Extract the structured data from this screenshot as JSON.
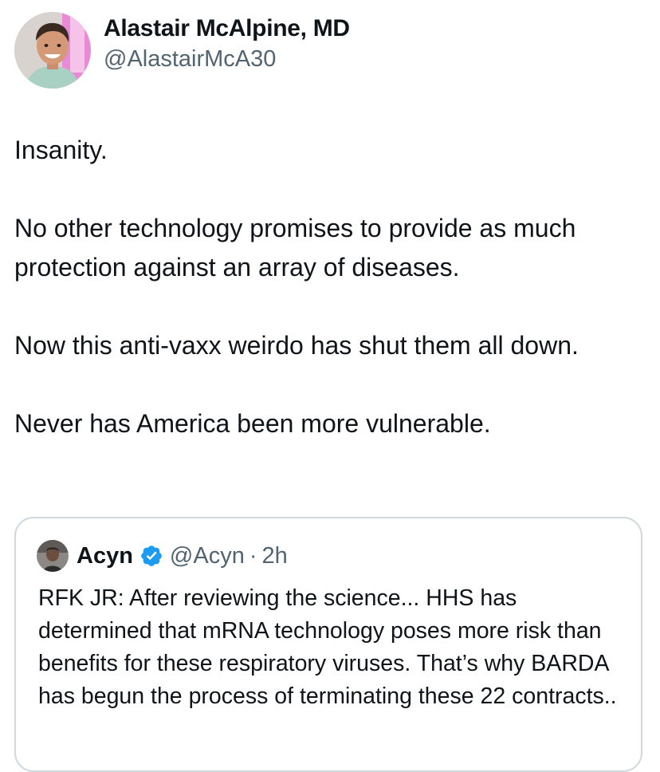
{
  "author": {
    "display_name": "Alastair McAlpine, MD",
    "handle": "@AlastairMcA30",
    "avatar_icon": "profile-photo"
  },
  "tweet": {
    "paragraphs": [
      "Insanity.",
      "No other technology promises to provide as much protection against an array of diseases.",
      "Now this anti-vaxx weirdo has shut them all down.",
      "Never has America been more vulnerable."
    ]
  },
  "quoted_tweet": {
    "display_name": "Acyn",
    "verified_icon": "verified-badge-icon",
    "verified_color": "#1d9bf0",
    "handle": "@Acyn",
    "separator": "·",
    "time": "2h",
    "text": "RFK JR: After reviewing the science... HHS has determined that mRNA technology poses more risk than benefits for these respiratory viruses. That’s why BARDA has begun the process of terminating these 22 contracts.."
  },
  "colors": {
    "text": "#0f1419",
    "secondary": "#536471",
    "border": "#cfd9de"
  }
}
